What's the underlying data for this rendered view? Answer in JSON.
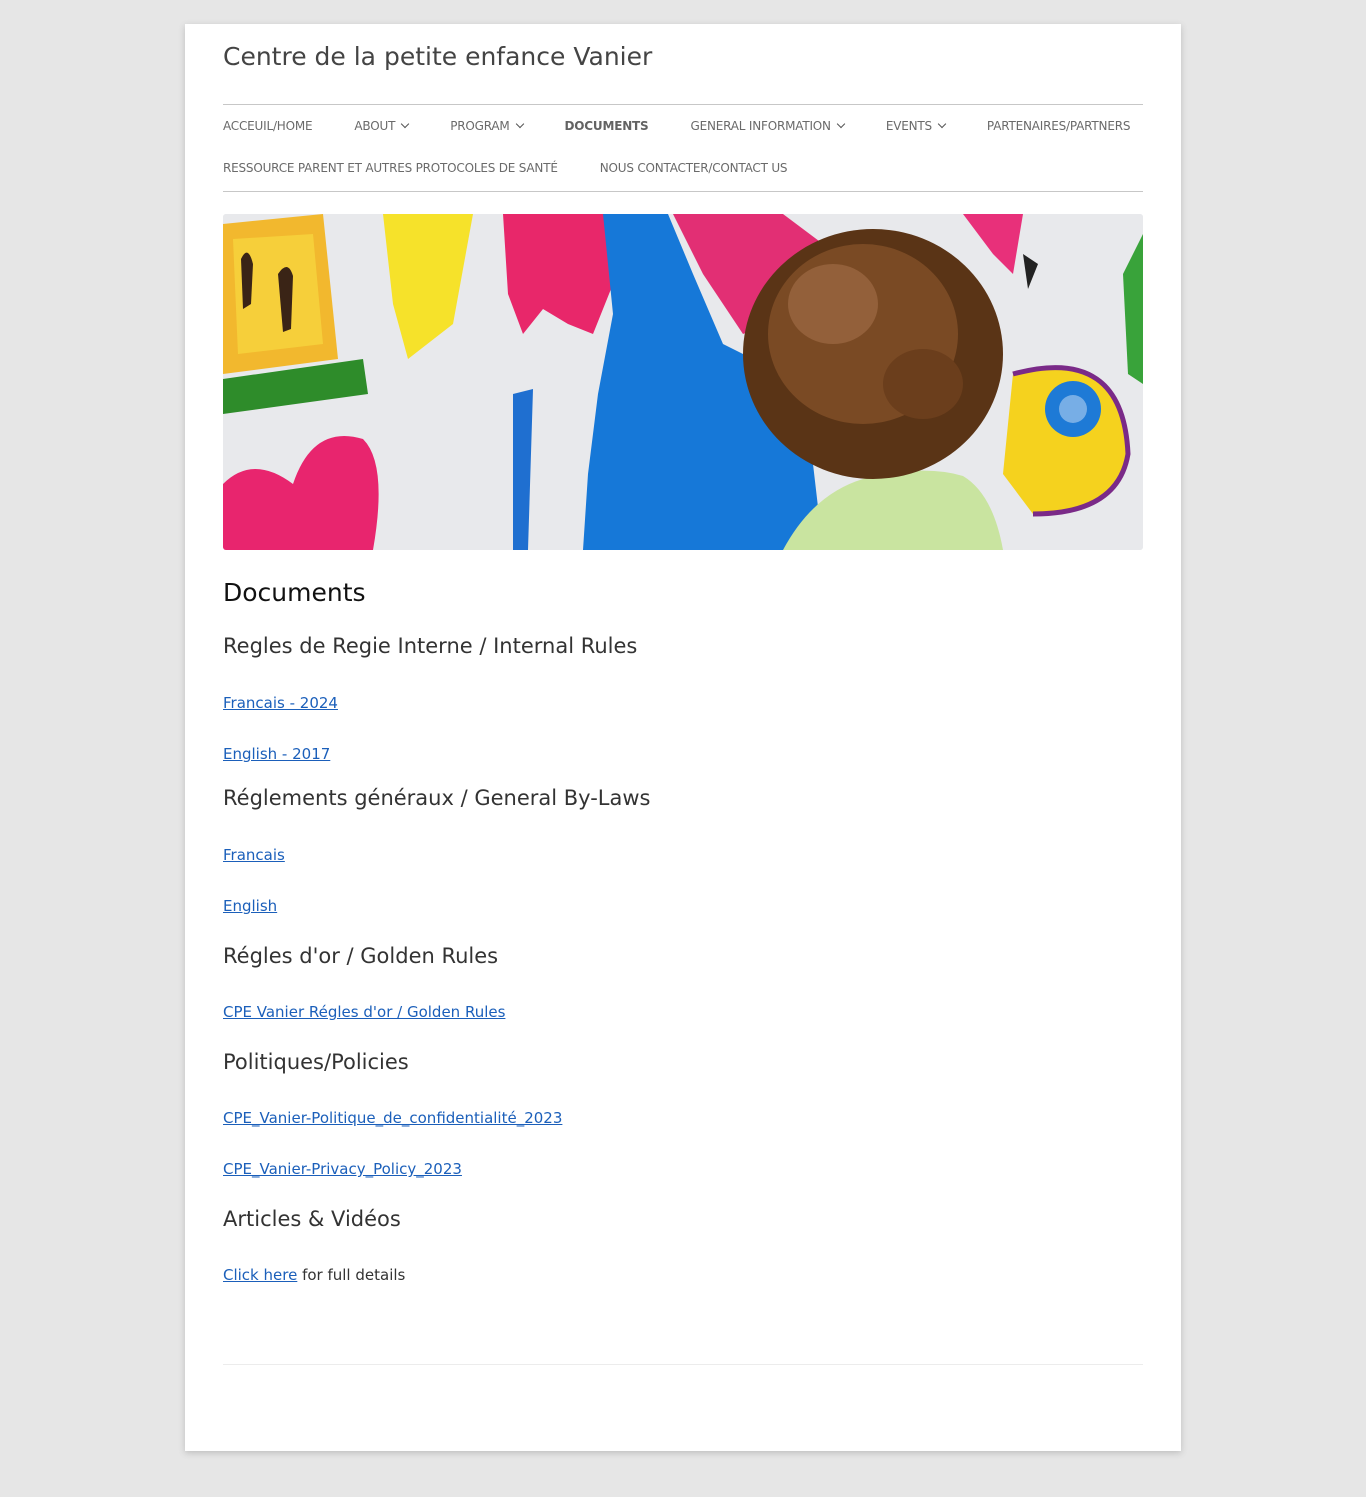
{
  "site": {
    "title": "Centre de la petite enfance Vanier"
  },
  "nav": {
    "row1": [
      {
        "label": "ACCEUIL/HOME",
        "dropdown": false
      },
      {
        "label": "ABOUT",
        "dropdown": true
      },
      {
        "label": "PROGRAM",
        "dropdown": true
      },
      {
        "label": "DOCUMENTS",
        "dropdown": false,
        "current": true
      },
      {
        "label": "GENERAL INFORMATION",
        "dropdown": true
      },
      {
        "label": "EVENTS",
        "dropdown": true
      },
      {
        "label": "PARTENAIRES/PARTNERS",
        "dropdown": false
      }
    ],
    "row2": [
      {
        "label": "RESSOURCE PARENT ET AUTRES PROTOCOLES DE SANTÉ",
        "dropdown": false
      },
      {
        "label": "NOUS CONTACTER/CONTACT US",
        "dropdown": false
      }
    ]
  },
  "page": {
    "title": "Documents",
    "sections": [
      {
        "heading": "Regles de Regie Interne / Internal Rules",
        "links": [
          "Francais - 2024",
          "English - 2017"
        ]
      },
      {
        "heading": "Réglements généraux / General By-Laws",
        "links": [
          "Francais",
          "English"
        ]
      },
      {
        "heading": "Régles d'or / Golden Rules",
        "links": [
          "CPE Vanier Régles d'or / Golden Rules"
        ]
      },
      {
        "heading": "Politiques/Policies",
        "links": [
          "CPE_Vanier-Politique_de_confidentialité_2023",
          "CPE_Vanier-Privacy_Policy_2023"
        ]
      },
      {
        "heading": "Articles & Vidéos",
        "link_text": "Click here",
        "trailing_text": " for full details"
      }
    ]
  },
  "colors": {
    "link": "#1b5fba",
    "background": "#e6e6e6"
  }
}
